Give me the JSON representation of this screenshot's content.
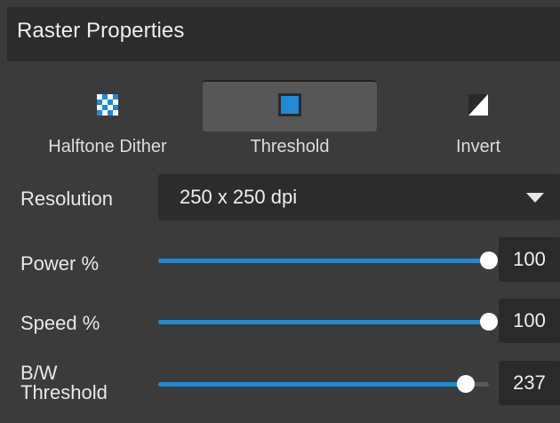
{
  "panel": {
    "title": "Raster Properties"
  },
  "modes": [
    {
      "label": "Halftone Dither",
      "icon": "halftone-dither-icon",
      "selected": false
    },
    {
      "label": "Threshold",
      "icon": "threshold-icon",
      "selected": true
    },
    {
      "label": "Invert",
      "icon": "invert-icon",
      "selected": false
    }
  ],
  "resolution": {
    "label": "Resolution",
    "value": "250 x 250 dpi"
  },
  "power": {
    "label": "Power %",
    "value": "100",
    "level": 1.0
  },
  "speed": {
    "label": "Speed %",
    "value": "100",
    "level": 1.0
  },
  "bw_threshold": {
    "label_line1": "B/W",
    "label_line2": "Threshold",
    "value": "237",
    "level": 0.93
  },
  "colors": {
    "accent": "#1e8ad6",
    "panel_bg": "#3b3b3b",
    "header_bg": "#2c2c2c",
    "selected_mode_bg": "#575757"
  }
}
